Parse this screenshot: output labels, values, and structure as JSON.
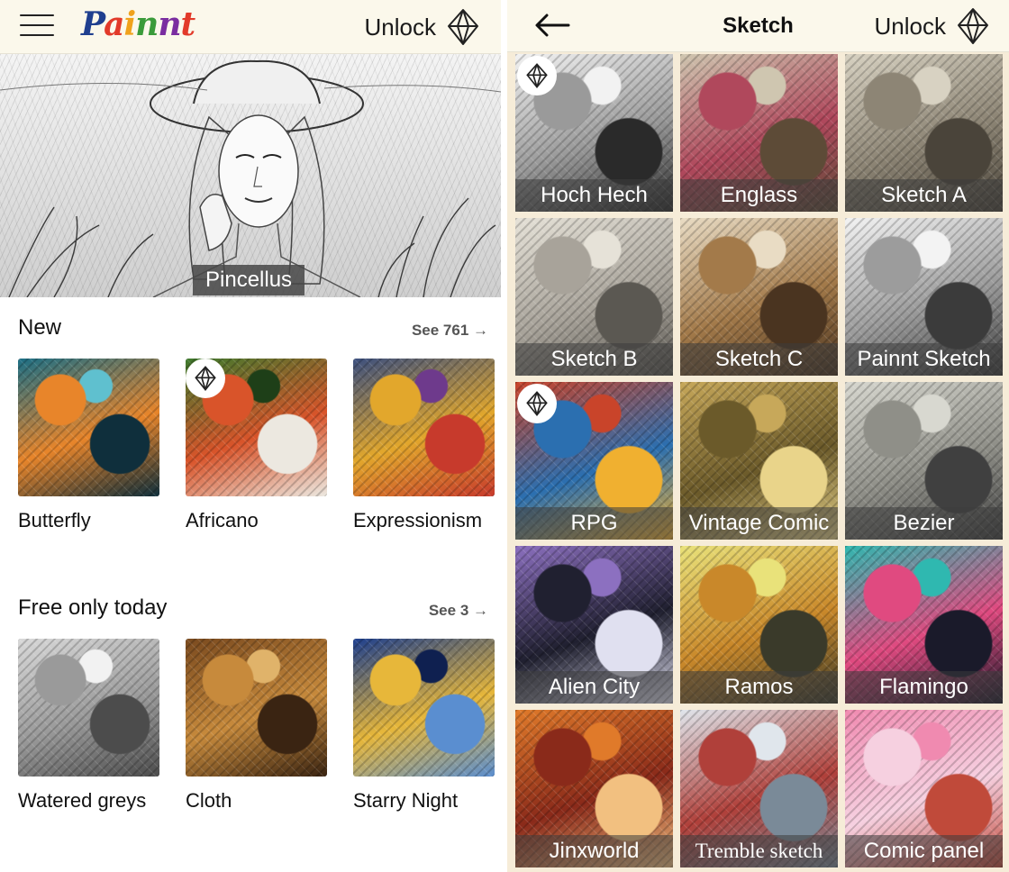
{
  "left": {
    "logo_text": "Painnt",
    "logo_colors": [
      "#1f3f8f",
      "#e23a2a",
      "#f0a21c",
      "#3a9b3a",
      "#7a2da0",
      "#e23a2a"
    ],
    "menu_icon": "hamburger-icon",
    "unlock_label": "Unlock",
    "unlock_icon": "diamond-icon",
    "hero_label": "Pincellus",
    "sections": [
      {
        "title": "New",
        "see_label": "See 761 →",
        "items": [
          {
            "caption": "Butterfly",
            "premium": false,
            "colors": [
              "#1b6f86",
              "#e8852a",
              "#0f2f3c",
              "#5fc0cf"
            ]
          },
          {
            "caption": "Africano",
            "premium": true,
            "colors": [
              "#3d7a2d",
              "#d9542a",
              "#ece8e0",
              "#1e3f18"
            ]
          },
          {
            "caption": "Expressionism",
            "premium": false,
            "colors": [
              "#3b4f7f",
              "#e2a72c",
              "#c73a2c",
              "#6e3a8c"
            ]
          }
        ]
      },
      {
        "title": "Free only today",
        "see_label": "See 3 →",
        "items": [
          {
            "caption": "Watered greys",
            "premium": false,
            "colors": [
              "#d9d9d9",
              "#9a9a9a",
              "#4c4c4c",
              "#f2f2f2"
            ]
          },
          {
            "caption": "Cloth",
            "premium": false,
            "colors": [
              "#7a4a1f",
              "#c78a3c",
              "#3a2412",
              "#e0b36a"
            ]
          },
          {
            "caption": "Starry Night",
            "premium": false,
            "colors": [
              "#1d3f8f",
              "#e7b73a",
              "#5a8ed0",
              "#0f2050"
            ]
          }
        ]
      }
    ]
  },
  "right": {
    "back_icon": "back-arrow-icon",
    "title": "Sketch",
    "unlock_label": "Unlock",
    "unlock_icon": "diamond-icon",
    "tiles": [
      {
        "label": "Hoch Hech",
        "premium": true,
        "colors": [
          "#f2f2f2",
          "#9a9a9a",
          "#2a2a2a"
        ]
      },
      {
        "label": "Englass",
        "premium": false,
        "colors": [
          "#cfc6b0",
          "#b0485c",
          "#5d4b37"
        ]
      },
      {
        "label": "Sketch A",
        "premium": false,
        "colors": [
          "#d8d2c2",
          "#8d8575",
          "#4a443a"
        ]
      },
      {
        "label": "Sketch B",
        "premium": false,
        "colors": [
          "#e6e2d8",
          "#a8a39a",
          "#5b5852"
        ]
      },
      {
        "label": "Sketch C",
        "premium": false,
        "colors": [
          "#e9dcc4",
          "#a37a4a",
          "#4a3420"
        ]
      },
      {
        "label": "Painnt Sketch",
        "premium": false,
        "colors": [
          "#f3f3f3",
          "#9c9c9c",
          "#3b3b3b"
        ]
      },
      {
        "label": "RPG",
        "premium": true,
        "colors": [
          "#c9442a",
          "#2b6fb0",
          "#f0b030"
        ]
      },
      {
        "label": "Vintage Comic",
        "premium": false,
        "colors": [
          "#c7a85a",
          "#6b5a2a",
          "#e9d48a"
        ]
      },
      {
        "label": "Bezier",
        "premium": false,
        "colors": [
          "#d8d8d0",
          "#8f8f88",
          "#404040"
        ]
      },
      {
        "label": "Alien City",
        "premium": false,
        "colors": [
          "#8c70c0",
          "#202030",
          "#e0e0f0"
        ]
      },
      {
        "label": "Ramos",
        "premium": false,
        "colors": [
          "#e9e27a",
          "#c9882a",
          "#3a3a2a"
        ]
      },
      {
        "label": "Flamingo",
        "premium": false,
        "colors": [
          "#2fb8b0",
          "#e04a80",
          "#1a1a2a"
        ]
      },
      {
        "label": "Jinxworld",
        "premium": false,
        "colors": [
          "#e07a2a",
          "#8a2a1a",
          "#f2c080"
        ]
      },
      {
        "label": "Tremble sketch",
        "premium": false,
        "serif": true,
        "colors": [
          "#e0e6ec",
          "#b0403a",
          "#7a8a98"
        ]
      },
      {
        "label": "Comic panel",
        "premium": false,
        "colors": [
          "#f08ab0",
          "#f6d0e0",
          "#c04a3a"
        ]
      }
    ]
  },
  "colors": {
    "header_bg": "#fbf8eb",
    "grid_bg": "#f6ecd8",
    "divider": "#e6e2d4"
  }
}
